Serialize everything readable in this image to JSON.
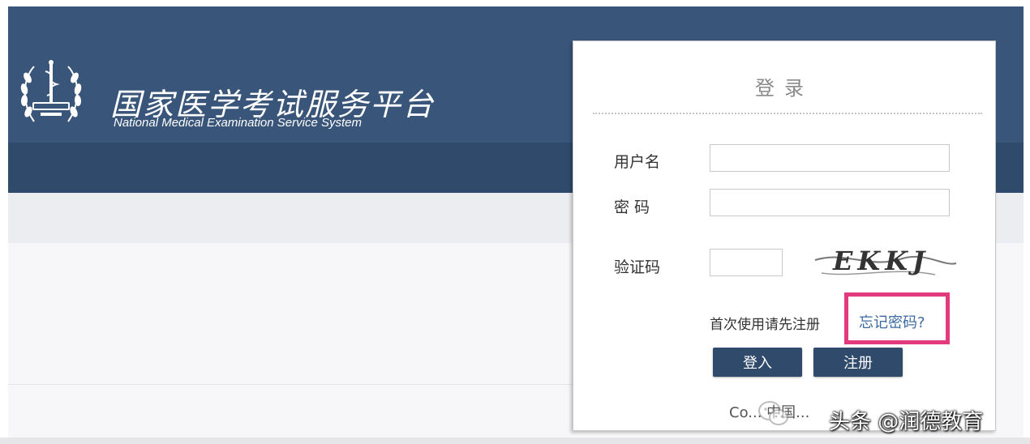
{
  "site": {
    "title": "国家医学考试服务平台",
    "subtitle": "National Medical Examination Service System",
    "logo_icon": "medical-caduceus-laurel-logo"
  },
  "login": {
    "title": "登录",
    "username_label": "用户名",
    "username_value": "",
    "password_label": "密 码",
    "password_value": "",
    "captcha_label": "验证码",
    "captcha_value": "",
    "captcha_text": "EKKJ",
    "first_use_text": "首次使用请先注册",
    "forgot_password_link": "忘记密码?",
    "login_button": "登入",
    "register_button": "注册",
    "copyright_text": "Co... 中国..."
  },
  "watermark": {
    "text": "头条 @润德教育",
    "icon": "wechat-icon"
  },
  "colors": {
    "header": "#39567a",
    "header_dark": "#2f4a6b",
    "highlight": "#e23a7c",
    "link": "#3c6aa0"
  }
}
